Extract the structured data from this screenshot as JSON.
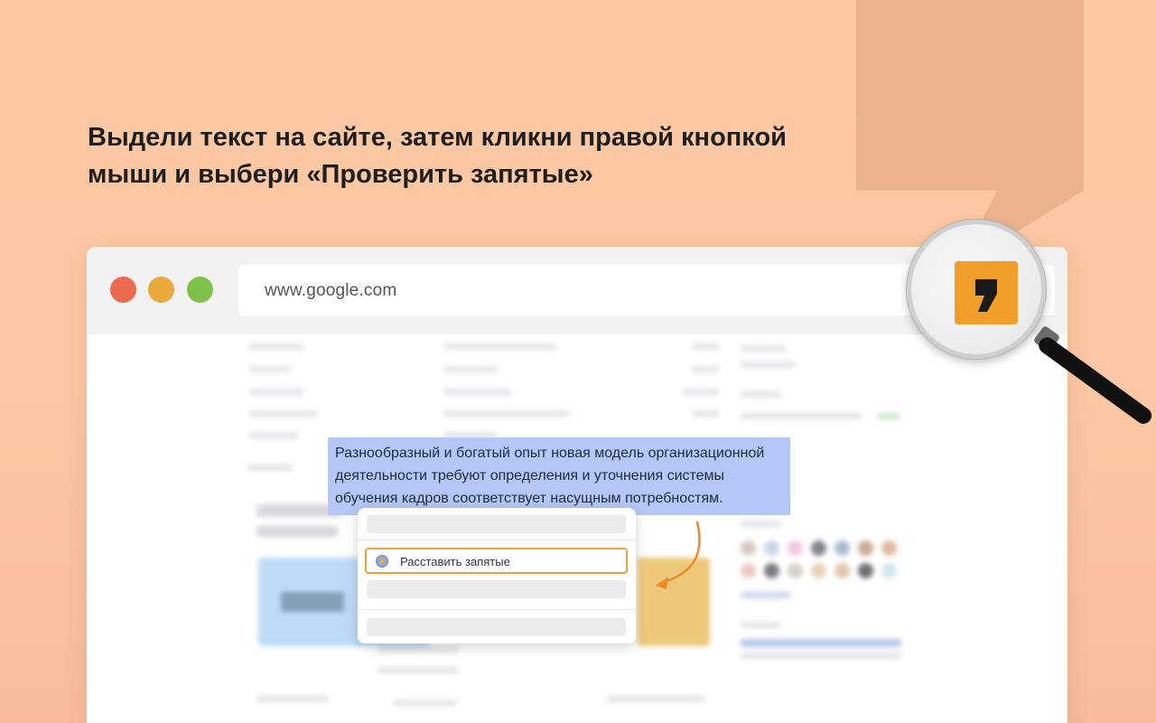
{
  "headline": {
    "line1": "Выдели текст на сайте, затем кликни правой кнопкой",
    "line2": "мыши и выбери «Проверить запятые»"
  },
  "browser": {
    "window_controls": [
      "close",
      "minimize",
      "maximize"
    ],
    "url": "www.google.com",
    "extension_icon": "comma-logo-icon"
  },
  "selection": {
    "text": "Разнообразный и богатый опыт новая модель организационной деятельности требуют определения и уточнения системы обучения кадров соответствует насущным потребностям."
  },
  "context_menu": {
    "action_label": "Расставить запятые"
  },
  "colors": {
    "background": "#fcc7a4",
    "accent_orange": "#f0a02a",
    "selection_blue": "#b5c7f7",
    "menu_highlight_border": "#e9a33a"
  }
}
